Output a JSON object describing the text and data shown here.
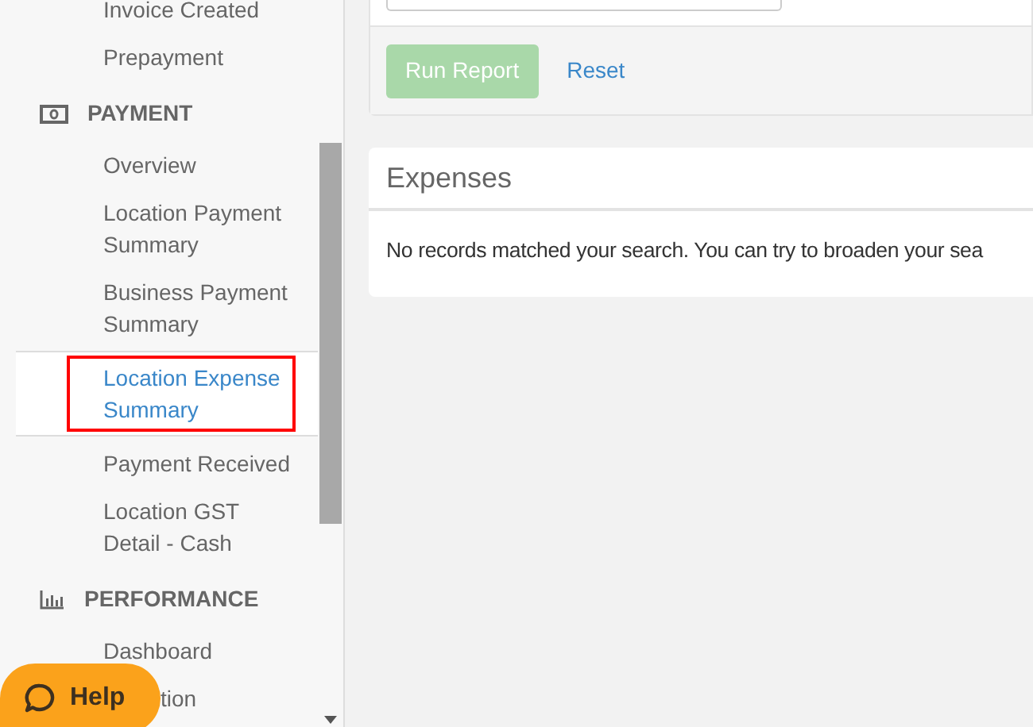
{
  "sidebar": {
    "items": [
      {
        "kind": "link",
        "label": "Invoice Created",
        "selected": false
      },
      {
        "kind": "link",
        "label": "Prepayment",
        "selected": false
      },
      {
        "kind": "section",
        "label": "PAYMENT"
      },
      {
        "kind": "link",
        "label": "Overview",
        "selected": false
      },
      {
        "kind": "link",
        "label": "Location Payment Summary",
        "selected": false
      },
      {
        "kind": "link",
        "label": "Business Payment Summary",
        "selected": false
      },
      {
        "kind": "link",
        "label": "Location Expense Summary",
        "selected": true
      },
      {
        "kind": "link",
        "label": "Payment Received",
        "selected": false
      },
      {
        "kind": "link",
        "label": "Location GST Detail - Cash",
        "selected": false
      },
      {
        "kind": "section",
        "label": "PERFORMANCE"
      },
      {
        "kind": "link",
        "label": "Dashboard",
        "selected": false
      },
      {
        "kind": "covered_link",
        "label": "tion",
        "selected": false
      }
    ]
  },
  "filters": {
    "run_button": "Run Report",
    "reset_link": "Reset"
  },
  "expenses": {
    "title": "Expenses",
    "message": "No records matched your search. You can try to broaden your sea"
  },
  "help_button": "Help"
}
